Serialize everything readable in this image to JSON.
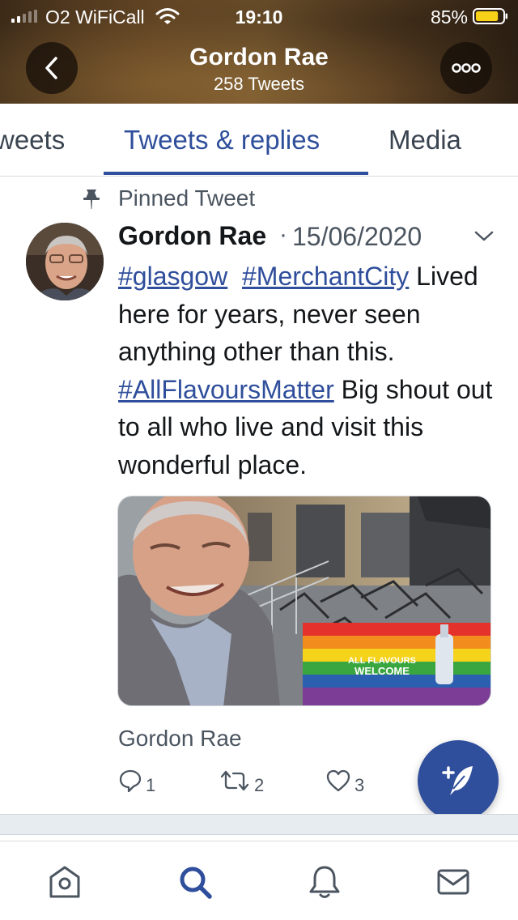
{
  "status_bar": {
    "carrier": "O2 WiFiCall",
    "time": "19:10",
    "battery_percent": "85%",
    "battery_level": 0.85,
    "signal_bars": 2
  },
  "header": {
    "title": "Gordon Rae",
    "subtitle": "258 Tweets",
    "back_icon": "chevron-left-icon",
    "more_icon": "ellipsis-icon"
  },
  "tabs": [
    {
      "label": "Tweets",
      "visible_label": "weets",
      "active": false
    },
    {
      "label": "Tweets & replies",
      "active": true
    },
    {
      "label": "Media",
      "active": false
    }
  ],
  "tweet": {
    "pinned_label": "Pinned Tweet",
    "author": "Gordon Rae",
    "separator": "·",
    "date": "15/06/2020",
    "hashtag_1": "#glasgow",
    "hashtag_2": "#MerchantCity",
    "text_1": "Lived here for years, never seen anything other than this.",
    "hashtag_3": "#AllFlavoursMatter",
    "text_2": "Big shout out to all who live and visit this wonderful place.",
    "media_sign_text": "ALL FLAVOURS WELCOME",
    "media_credit": "Gordon Rae",
    "reply_count": "1",
    "retweet_count": "2",
    "like_count": "3"
  },
  "colors": {
    "accent": "#2f4e9b",
    "text_secondary": "#4b5560",
    "battery": "#f7d117"
  },
  "bottom_nav": {
    "items": [
      "home-icon",
      "search-icon",
      "bell-icon",
      "mail-icon"
    ],
    "active": "search-icon"
  },
  "fab_icon": "compose-tweet-icon"
}
